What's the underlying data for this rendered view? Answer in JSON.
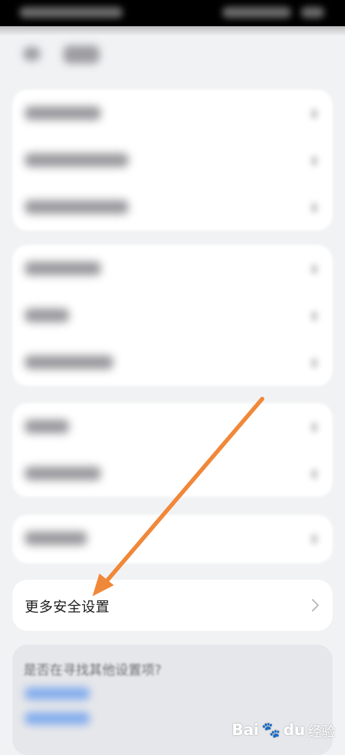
{
  "settings_item": {
    "label": "更多安全设置"
  },
  "faq": {
    "question": "是否在寻找其他设置项?"
  },
  "watermark": {
    "brand": "Bai",
    "paw": "🐾",
    "brand_suffix": "du",
    "sub": "经验"
  },
  "annotation": {
    "arrow_color": "#f0883a"
  }
}
